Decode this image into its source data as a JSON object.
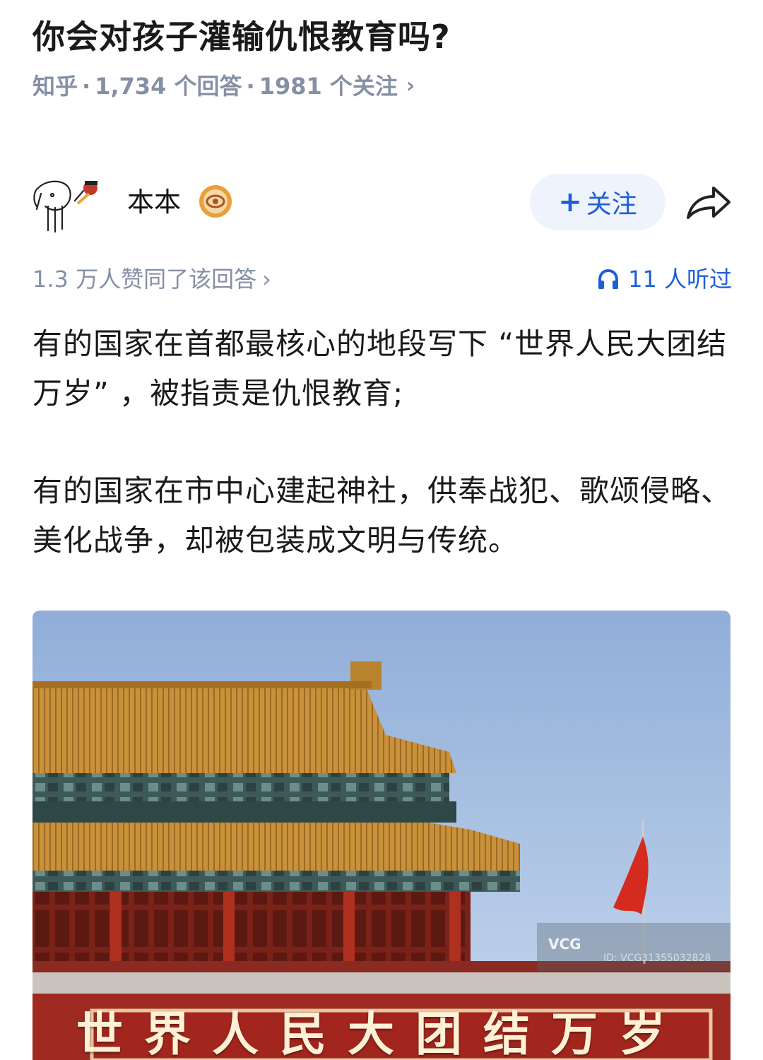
{
  "question": {
    "title": "你会对孩子灌输仇恨教育吗?",
    "source": "知乎",
    "answers": "1,734 个回答",
    "followers": "1981 个关注",
    "chevron": "›"
  },
  "author": {
    "name": "本本",
    "follow_label": "关注",
    "follow_plus": "+"
  },
  "stats": {
    "likes": "1.3 万人赞同了该回答",
    "likes_chevron": "›",
    "listeners": "11 人听过"
  },
  "content": {
    "paragraph_1": "有的国家在首都最核心的地段写下 “世界人民大团结万岁” ，被指责是仇恨教育;",
    "paragraph_2": "有的国家在市中心建起神社，供奉战犯、歌颂侵略、美化战争，却被包装成文明与传统。"
  },
  "photo": {
    "banner_text": "世界人民大团结万岁",
    "watermark_brand": "VCG",
    "watermark_id": "ID: VCG31355032828"
  },
  "colors": {
    "accent_blue": "#1e5fd6",
    "meta_gray": "#8590a6",
    "follow_bg": "#eef3fd",
    "wall_red": "#9e2a22",
    "roof_gold": "#c8913a"
  },
  "icons": {
    "avatar": "cartoon-dog-avatar",
    "badge": "coin-eye-badge-icon",
    "share": "share-arrow-icon",
    "listen": "headphones-icon"
  }
}
